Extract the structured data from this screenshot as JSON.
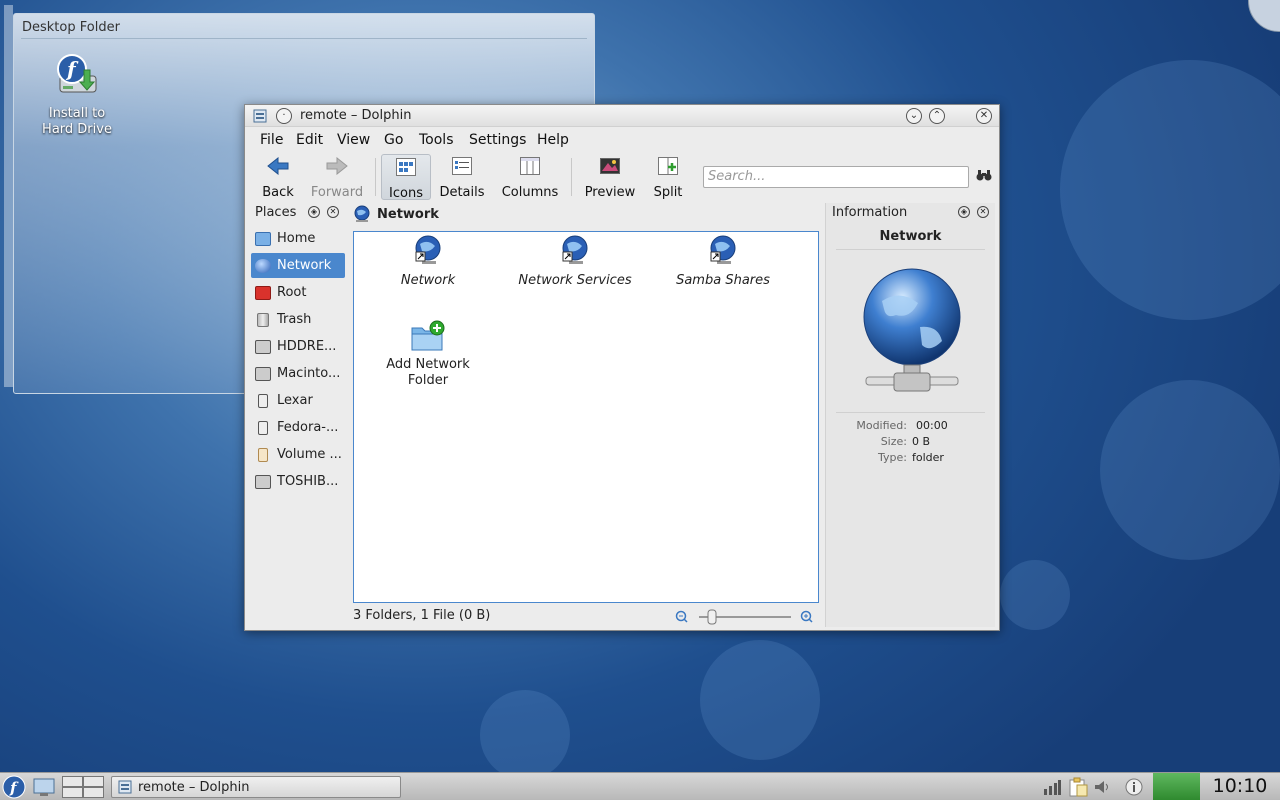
{
  "desktop": {
    "folder_title": "Desktop Folder",
    "icon_label_line1": "Install to",
    "icon_label_line2": "Hard Drive"
  },
  "window": {
    "title": "remote – Dolphin",
    "menu": [
      "File",
      "Edit",
      "View",
      "Go",
      "Tools",
      "Settings",
      "Help"
    ],
    "toolbar": {
      "back": "Back",
      "forward": "Forward",
      "icons": "Icons",
      "details": "Details",
      "columns": "Columns",
      "preview": "Preview",
      "split": "Split"
    },
    "search_placeholder": "Search...",
    "places": {
      "title": "Places",
      "items": [
        {
          "label": "Home",
          "icon": "home-folder-icon"
        },
        {
          "label": "Network",
          "icon": "network-globe-icon"
        },
        {
          "label": "Root",
          "icon": "root-folder-icon"
        },
        {
          "label": "Trash",
          "icon": "trash-icon"
        },
        {
          "label": "HDDRE...",
          "icon": "hard-drive-icon"
        },
        {
          "label": "Macinto...",
          "icon": "hard-drive-icon"
        },
        {
          "label": "Lexar",
          "icon": "removable-drive-icon"
        },
        {
          "label": "Fedora-...",
          "icon": "removable-drive-icon"
        },
        {
          "label": "Volume ...",
          "icon": "usb-drive-icon"
        },
        {
          "label": "TOSHIB...",
          "icon": "hard-drive-icon"
        }
      ]
    },
    "location": "Network",
    "items": [
      {
        "label": "Network"
      },
      {
        "label": "Network Services"
      },
      {
        "label": "Samba Shares"
      },
      {
        "label_line1": "Add Network",
        "label_line2": "Folder"
      }
    ],
    "status": "3 Folders, 1 File (0 B)",
    "info": {
      "title": "Information",
      "name": "Network",
      "modified_label": "Modified:",
      "modified_value": "00:00",
      "size_label": "Size:",
      "size_value": "0 B",
      "type_label": "Type:",
      "type_value": "folder"
    }
  },
  "taskbar": {
    "task_label": "remote – Dolphin",
    "clock": "10:10"
  },
  "colors": {
    "selection": "#4a87cd",
    "desktop": "#1f4f8e"
  }
}
